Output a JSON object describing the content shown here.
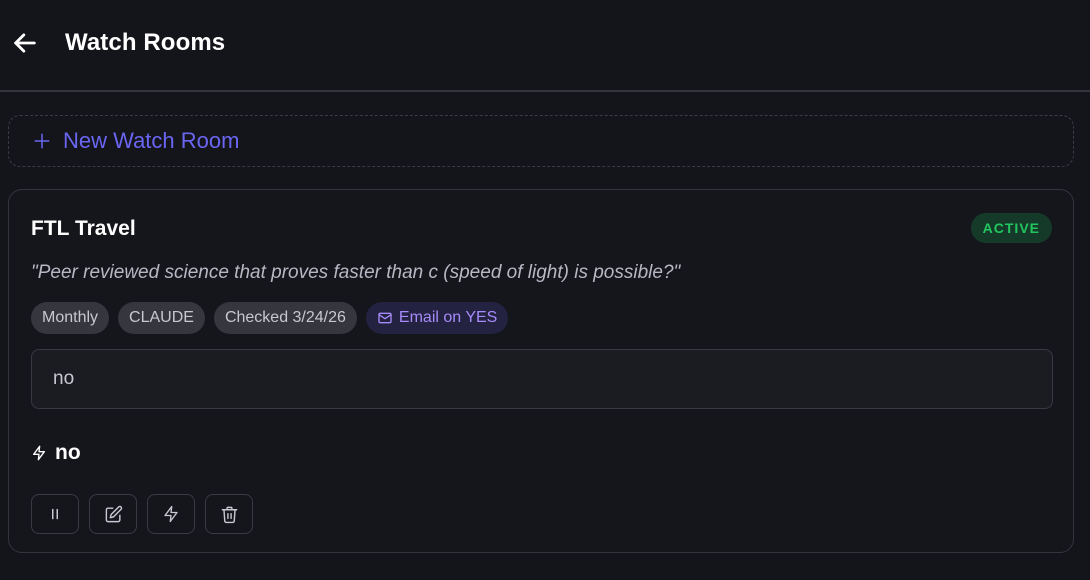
{
  "header": {
    "title": "Watch Rooms",
    "back_icon": "arrow-left-icon"
  },
  "new_room": {
    "label": "New Watch Room",
    "icon": "plus-icon",
    "accent_color": "#6a66f2"
  },
  "room": {
    "name": "FTL Travel",
    "status": "ACTIVE",
    "status_color": "#22c55e",
    "query": "\"Peer reviewed science that proves faster than c (speed of light) is possible?\"",
    "chips": {
      "frequency": "Monthly",
      "model": "CLAUDE",
      "checked": "Checked 3/24/26",
      "email": "Email on YES"
    },
    "answer": "no",
    "result": "no",
    "actions": [
      "pause-icon",
      "edit-icon",
      "zap-icon",
      "trash-icon"
    ]
  }
}
